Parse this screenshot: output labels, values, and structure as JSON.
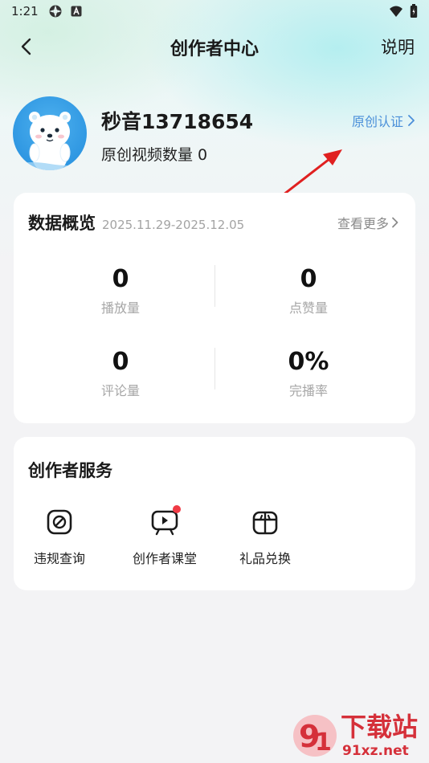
{
  "status_bar": {
    "time": "1:21",
    "icons": [
      "settings-icon",
      "a-badge-icon",
      "wifi-icon",
      "battery-icon"
    ]
  },
  "nav": {
    "title": "创作者中心",
    "help_label": "说明",
    "back_icon": "chevron-left-icon"
  },
  "profile": {
    "username": "秒音13718654",
    "video_count_label": "原创视频数量",
    "video_count": "0",
    "certify_label": "原创认证",
    "avatar": "polar-bear-avatar"
  },
  "overview": {
    "title": "数据概览",
    "date_range": "2025.11.29-2025.12.05",
    "more_label": "查看更多",
    "stats": [
      {
        "value": "0",
        "label": "播放量"
      },
      {
        "value": "0",
        "label": "点赞量"
      },
      {
        "value": "0",
        "label": "评论量"
      },
      {
        "value": "0%",
        "label": "完播率"
      }
    ]
  },
  "services": {
    "title": "创作者服务",
    "items": [
      {
        "label": "违规查询",
        "icon": "prohibited-icon"
      },
      {
        "label": "创作者课堂",
        "icon": "video-class-icon"
      },
      {
        "label": "礼品兑换",
        "icon": "gift-icon"
      }
    ]
  },
  "annotation": {
    "arrow_color": "#e02020"
  },
  "watermark": {
    "logo_text": "下载站",
    "url_text": "91xz.net"
  },
  "colors": {
    "accent_link": "#4a8fd9",
    "badge_red": "#f03a45"
  }
}
